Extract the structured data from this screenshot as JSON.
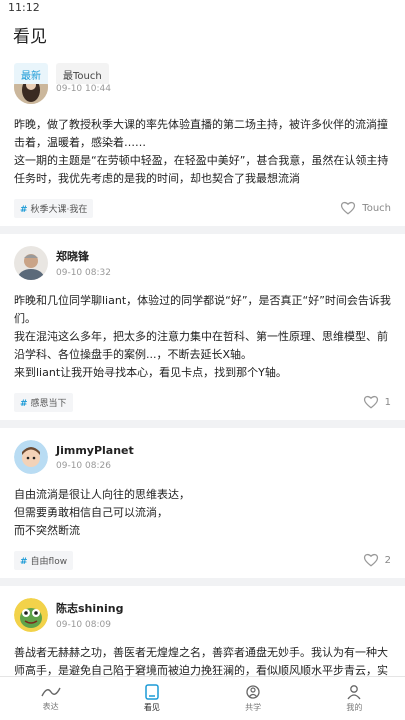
{
  "status_bar": {
    "time": "11:12"
  },
  "header": {
    "title": "看见"
  },
  "tabs": [
    {
      "label": "最新",
      "active": true
    },
    {
      "label": "最Touch",
      "active": false
    }
  ],
  "posts": [
    {
      "name": "",
      "date": "09-10 10:44",
      "lines": [
        "昨晚，做了教授秋季大课的率先体验直播的第二场主持，被许多伙伴的流淌撞击着，温暖着，感染着……",
        "这一期的主题是“在劳顿中轻盈，在轻盈中美好”，甚合我意，虽然在认领主持任务时，我优先考虑的是我的时间，却也契合了我最想流淌"
      ],
      "topic": "秋季大课·我在",
      "like_label": "Touch"
    },
    {
      "name": "郑晓锋",
      "date": "09-10 08:32",
      "lines": [
        "昨晚和几位同学聊liant，体验过的同学都说“好”，是否真正“好”时间会告诉我们。",
        "我在混沌这么多年，把太多的注意力集中在哲科、第一性原理、思维模型、前沿学科、各位操盘手的案例...，不断去延长X轴。",
        "来到liant让我开始寻找本心，看见卡点，找到那个Y轴。"
      ],
      "topic": "感恩当下",
      "like_label": "1"
    },
    {
      "name": "JimmyPlanet",
      "date": "09-10 08:26",
      "lines": [
        "自由流淌是很让人向往的思维表达，",
        "但需要勇敢相信自己可以流淌，",
        "而不突然断流"
      ],
      "topic": "自由flow",
      "like_label": "2"
    },
    {
      "name": "陈志shining",
      "date": "09-10 08:09",
      "lines": [
        "善战者无赫赫之功，善医者无煌煌之名，善弈者通盘无妙手。我认为有一种大师高手，是避免自己陷于窘境而被迫力挽狂澜的，看似顺风顺水平步青云，实则极富远见和高超的操盘能力[微笑]"
      ],
      "topic": "",
      "like_label": ""
    }
  ],
  "bottom_nav": [
    {
      "label": "表达",
      "icon": "wave-icon",
      "active": false
    },
    {
      "label": "看见",
      "icon": "tablet-icon",
      "active": true
    },
    {
      "label": "共学",
      "icon": "group-icon",
      "active": false
    },
    {
      "label": "我的",
      "icon": "person-icon",
      "active": false
    }
  ],
  "colors": {
    "accent": "#1b9ad6",
    "background": "#f1f2f4"
  }
}
